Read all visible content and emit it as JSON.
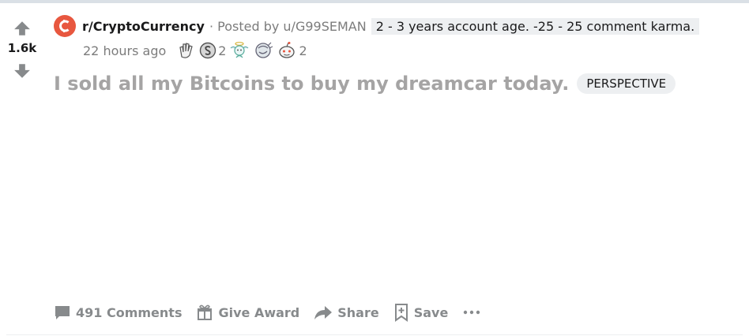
{
  "vote": {
    "score": "1.6k",
    "upvote_icon": "arrow-up-icon",
    "downvote_icon": "arrow-down-icon"
  },
  "post": {
    "subreddit": "r/CryptoCurrency",
    "posted_by": "· Posted by u/G99SEMAN",
    "user_flair": "2 - 3 years account age. -25 - 25 comment karma.",
    "time": "22 hours ago",
    "title": "I sold all my Bitcoins to buy my dreamcar today.",
    "post_flair": "PERSPECTIVE",
    "awards": [
      {
        "icon": "clapping-hands-icon",
        "count": ""
      },
      {
        "icon": "silver-coin-icon",
        "count": "2"
      },
      {
        "icon": "angel-award-icon",
        "count": ""
      },
      {
        "icon": "mind-blown-icon",
        "count": ""
      },
      {
        "icon": "snoo-award-icon",
        "count": "2"
      }
    ]
  },
  "actions": {
    "comments": "491 Comments",
    "give_award": "Give Award",
    "share": "Share",
    "save": "Save",
    "more_icon": "more-dots-icon"
  },
  "colors": {
    "subreddit_icon": "#e8573f",
    "muted": "#878a8c",
    "title": "#a5a4a4"
  }
}
